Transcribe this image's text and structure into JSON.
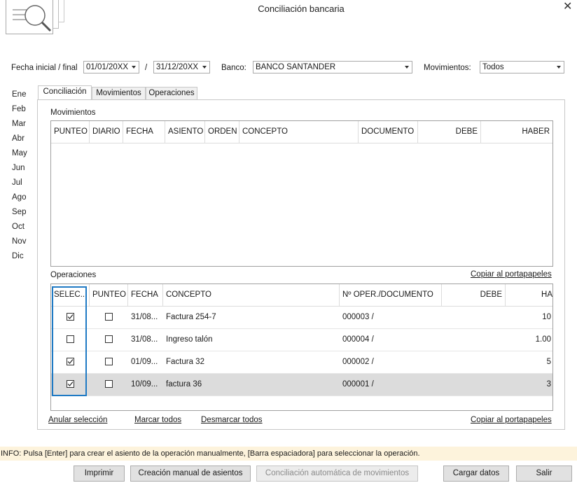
{
  "window": {
    "title": "Conciliación bancaria",
    "close_glyph": "✕"
  },
  "filters": {
    "date_label": "Fecha inicial / final",
    "date_start": "01/01/20XX",
    "date_sep": "/",
    "date_end": "31/12/20XX",
    "bank_label": "Banco:",
    "bank_value": "BANCO SANTANDER",
    "movements_label": "Movimientos:",
    "movements_value": "Todos"
  },
  "months": [
    "Ene",
    "Feb",
    "Mar",
    "Abr",
    "May",
    "Jun",
    "Jul",
    "Ago",
    "Sep",
    "Oct",
    "Nov",
    "Dic"
  ],
  "tabs": [
    {
      "label": "Conciliación",
      "active": true
    },
    {
      "label": "Movimientos",
      "active": false
    },
    {
      "label": "Operaciones",
      "active": false
    }
  ],
  "movimientos": {
    "section_label": "Movimientos",
    "columns": [
      "PUNTEO",
      "DIARIO",
      "FECHA",
      "ASIENTO",
      "ORDEN",
      "CONCEPTO",
      "DOCUMENTO",
      "DEBE",
      "HABER"
    ]
  },
  "operaciones": {
    "section_label": "Operaciones",
    "copy_link": "Copiar al portapapeles",
    "columns": [
      "SELEC...",
      "PUNTEO",
      "FECHA",
      "CONCEPTO",
      "Nº OPER./DOCUMENTO",
      "DEBE",
      "HA"
    ],
    "rows": [
      {
        "selected": true,
        "punteo": false,
        "fecha": "31/08...",
        "concepto": "Factura 254-7",
        "documento": "000003 /",
        "debe": "",
        "haber": "10"
      },
      {
        "selected": false,
        "punteo": false,
        "fecha": "31/08...",
        "concepto": "Ingreso talón",
        "documento": "000004 /",
        "debe": "",
        "haber": "1.00"
      },
      {
        "selected": true,
        "punteo": false,
        "fecha": "01/09...",
        "concepto": "Factura 32",
        "documento": "000002 /",
        "debe": "",
        "haber": "5"
      },
      {
        "selected": true,
        "punteo": false,
        "fecha": "10/09...",
        "concepto": "factura 36",
        "documento": "000001 /",
        "debe": "",
        "haber": "3"
      }
    ]
  },
  "footer_links": {
    "anular": "Anular selección",
    "marcar": "Marcar todos",
    "desmarcar": "Desmarcar todos",
    "copiar": "Copiar al portapapeles"
  },
  "info": "INFO: Pulsa [Enter] para crear el asiento de la operación manualmente, [Barra espaciadora] para seleccionar la operación.",
  "buttons": {
    "imprimir": "Imprimir",
    "creacion": "Creación manual de asientos",
    "conciliacion_auto": "Conciliación automática de movimientos",
    "cargar": "Cargar datos",
    "salir": "Salir"
  },
  "colors": {
    "selection_border": "#1f7ac4",
    "info_bg": "#fdf3dc",
    "selected_row_bg": "#dcdcdc"
  }
}
